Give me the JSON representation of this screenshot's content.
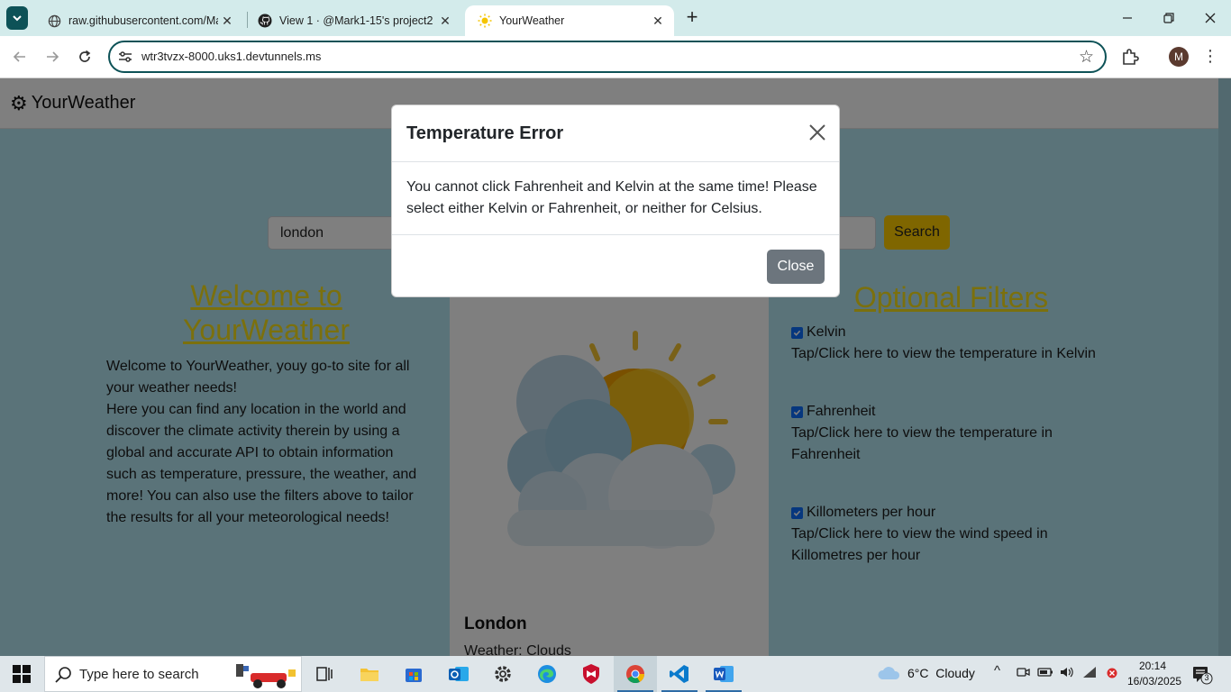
{
  "browser": {
    "tabs": [
      {
        "title": "raw.githubusercontent.com/Ma",
        "icon": "globe-icon"
      },
      {
        "title": "View 1 · @Mark1-15's project2",
        "icon": "github-icon"
      },
      {
        "title": "YourWeather",
        "icon": "sun-icon",
        "active": true
      }
    ],
    "url": "wtr3tvzx-8000.uks1.devtunnels.ms",
    "profile_initial": "M"
  },
  "site": {
    "brand": "YourWeather",
    "search_value": "london",
    "search_button": "Search",
    "welcome": {
      "heading": "Welcome to YourWeather",
      "paragraphs": [
        "Welcome to YourWeather, youy go-to site for all your weather needs!",
        "Here you can find any location in the world and discover the climate activity therein by using a global and accurate API to obtain information such as temperature, pressure, the weather, and more! You can also use the filters above to tailor the results for all your meteorological needs!"
      ]
    },
    "result": {
      "city": "London",
      "weather": "Weather: Clouds"
    },
    "filters": {
      "heading": "Optional Filters",
      "items": [
        {
          "label": "Kelvin",
          "checked": true,
          "desc": "Tap/Click here to view the temperature in Kelvin"
        },
        {
          "label": "Fahrenheit",
          "checked": true,
          "desc": "Tap/Click here to view the temperature in Fahrenheit"
        },
        {
          "label": "Killometers per hour",
          "checked": true,
          "desc": "Tap/Click here to view the wind speed in Killometres per hour"
        }
      ]
    }
  },
  "modal": {
    "title": "Temperature Error",
    "body": "You cannot click Fahrenheit and Kelvin at the same time! Please select either Kelvin or Fahrenheit, or neither for Celsius.",
    "close_button": "Close"
  },
  "taskbar": {
    "search_placeholder": "Type here to search",
    "weather": "6°C  Cloudy",
    "time": "20:14",
    "date": "16/03/2025",
    "notification_count": "3"
  },
  "colors": {
    "accent_yellow": "#ffcc00",
    "heading_yellow": "#f7e11a",
    "page_bg": "#b5e6f3",
    "chrome_teal": "#0d5257"
  }
}
